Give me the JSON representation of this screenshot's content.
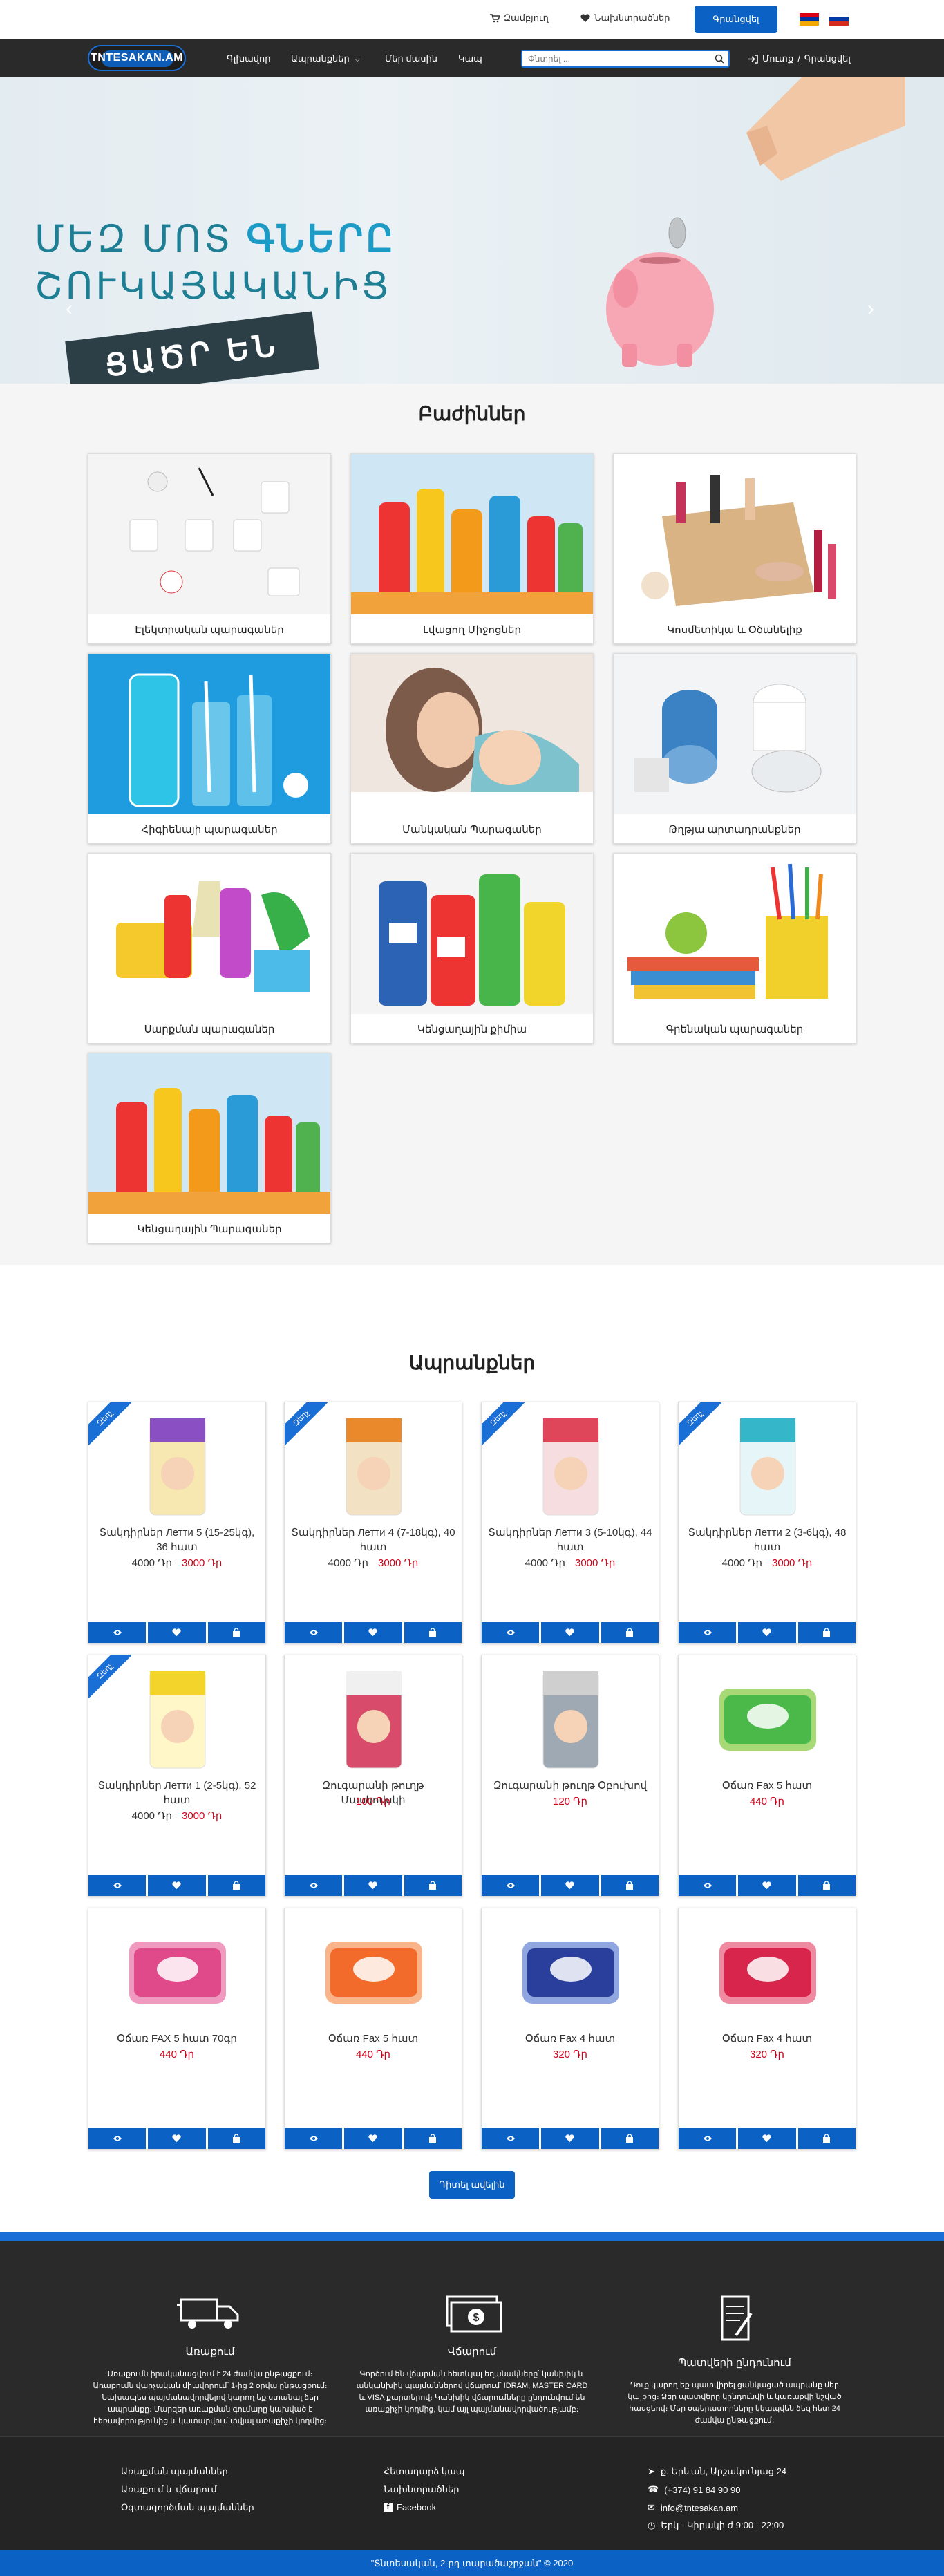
{
  "topbar": {
    "cart_label": "Զամբյուղ",
    "favorites_label": "Նախնտրածներ",
    "register_label": "Գրանցվել"
  },
  "navbar": {
    "logo": "TNTESAKAN.AM",
    "links": [
      "Գլխավոր",
      "Ապրանքներ",
      "Մեր մասին",
      "Կապ"
    ],
    "search_placeholder": "Փնտրել ...",
    "login_label": "Մուտք",
    "signup_label": "Գրանցվել"
  },
  "hero": {
    "line1_a": "ՄԵԶ ՄՈՏ",
    "line1_b": "ԳՆԵՐԸ",
    "line2": "ՇՈՒԿԱՅԱԿԱՆԻՑ",
    "tag": "ՑԱԾՐ ԵՆ"
  },
  "categories": {
    "title": "Բաժիններ",
    "items": [
      "Էլեկտրական պարագաներ",
      "Լվացող Միջոցներ",
      "Կոսմետիկա և Օծանելիք",
      "Հիգիենայի պարագաներ",
      "Մանկական Պարագաներ",
      "Թղթյա արտադրանքներ",
      "Սարքման պարագաներ",
      "Կենցաղային քիմիա",
      "Գրենական պարագաներ",
      "Կենցաղային Պարագաներ"
    ]
  },
  "products": {
    "title": "Ապրանքներ",
    "sale_badge": "Զեղչ",
    "items": [
      {
        "name": "Տակդիրներ Летти 5 (15-25կգ), 36 հատ",
        "old_price": "4000 Դր",
        "price": "3000 Դր",
        "sale": true
      },
      {
        "name": "Տակդիրներ Летти 4 (7-18կգ), 40 հատ",
        "old_price": "4000 Դր",
        "price": "3000 Դր",
        "sale": true
      },
      {
        "name": "Տակդիրներ Летти 3 (5-10կգ), 44 հատ",
        "old_price": "4000 Դր",
        "price": "3000 Դր",
        "sale": true
      },
      {
        "name": "Տակդիրներ Летти 2 (3-6կգ), 48 հատ",
        "old_price": "4000 Դր",
        "price": "3000 Դր",
        "sale": true
      },
      {
        "name": "Տակդիրներ Летти 1 (2-5կգ), 52 հատ",
        "old_price": "4000 Դր",
        "price": "3000 Դր",
        "sale": true
      },
      {
        "name": "Զուգարանի թուղթ Մասկովսկի",
        "old_price": "",
        "price": "100 Դր",
        "sale": false
      },
      {
        "name": "Զուգարանի թուղթ Օբուխով",
        "old_price": "",
        "price": "120 Դր",
        "sale": false
      },
      {
        "name": "Օճառ Fax 5 հատ",
        "old_price": "",
        "price": "440 Դր",
        "sale": false
      },
      {
        "name": "Օճառ FAX 5 հատ 70գր",
        "old_price": "",
        "price": "440 Դր",
        "sale": false
      },
      {
        "name": "Օճառ Fax 5 հատ",
        "old_price": "",
        "price": "440 Դր",
        "sale": false
      },
      {
        "name": "Օճառ Fax 4 հատ",
        "old_price": "",
        "price": "320 Դր",
        "sale": false
      },
      {
        "name": "Օճառ Fax 4 հատ",
        "old_price": "",
        "price": "320 Դր",
        "sale": false
      }
    ],
    "more_label": "Դիտել ավելին"
  },
  "footer": {
    "delivery_title": "Առաքում",
    "delivery_text": "Առաքումն իրականացվում է 24 ժամվա ընթացքում։ Առաքումն վարչական միավորում՝ 1-ից 2 օրվա ընթացքում։ Նախապես պայմանավորվելով կարող եք ստանալ ձեր ապրանքը։ Մարզեր առաքման գումարը կախված է հեռավորությունից և կատարվում տվյալ առաքիչի կողմից։",
    "payment_title": "Վճարում",
    "payment_text": "Գործում են վճարման հետևյալ եղանակները՝ կանխիկ և անկանխիկ պայմաններով վճարում՝ IDRAM, MASTER CARD և VISA քարտերով։ Կանխիկ վճարումները ընդունվում են առաքիչի կողմից, կամ այլ պայմանավորվածությամբ։",
    "terms_title": "Պատվերի ընդունում",
    "terms_text": "Դուք կարող եք պատվիրել ցանկացած ապրանք մեր կայքից։ Ձեր պատվերը կընդունվի և կառաքվի նշված հասցեով։ Մեր օպերատորները կկապվեն ձեզ հետ 24 ժամվա ընթացքում։",
    "links_col1": [
      "Առաքման պայմաններ",
      "Առաքում և վճարում",
      "Օգտագործման պայմաններ"
    ],
    "links_col2": [
      "Հետադարձ կապ",
      "Նախնտրածներ",
      "Facebook"
    ],
    "address": "ք. Երևան, Արշակունյաց 24",
    "phone": "(+374) 91 84 90 90",
    "email": "info@tntesakan.am",
    "hours": "Երկ - Կիրակի ժ 9:00 - 22:00",
    "copyright": "\"Տնտեսական, 2-րդ տարածաշրջան\" © 2020"
  },
  "colors": {
    "primary": "#0c62c4",
    "dark": "#2a2a2a",
    "price_red": "#d0021b"
  }
}
